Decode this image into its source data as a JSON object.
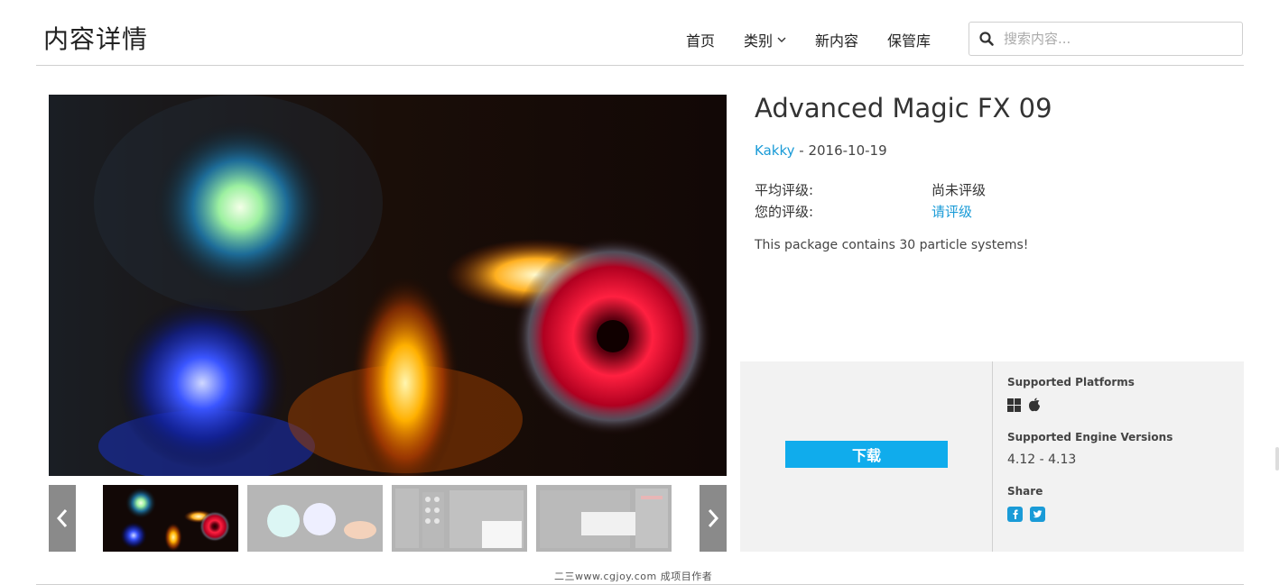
{
  "header": {
    "title": "内容详情",
    "nav": [
      {
        "label": "首页"
      },
      {
        "label": "类别",
        "has_dropdown": true
      },
      {
        "label": "新内容"
      },
      {
        "label": "保管库"
      }
    ],
    "search": {
      "placeholder": "搜索内容..."
    }
  },
  "asset": {
    "title": "Advanced Magic FX 09",
    "author": "Kakky",
    "separator": " - ",
    "date": "2016-10-19",
    "ratings": {
      "average_label": "平均评级:",
      "average_value": "尚未评级",
      "yours_label": "您的评级:",
      "yours_value": "请评级"
    },
    "description": "This package contains 30 particle systems!"
  },
  "gallery": {
    "active_index": 0,
    "thumb_count": 4
  },
  "panel": {
    "download_label": "下载",
    "platforms_label": "Supported Platforms",
    "platform_icons": [
      "windows-icon",
      "apple-icon"
    ],
    "engine_label": "Supported Engine Versions",
    "engine_versions": "4.12 - 4.13",
    "share_label": "Share",
    "share_icons": [
      "facebook-icon",
      "twitter-icon"
    ]
  },
  "watermark": "二三www.cgjoy.com 成项目作者",
  "colors": {
    "accent": "#10acec",
    "link": "#1a9bd7",
    "panel_bg": "#f2f2f2",
    "arrow_bg": "#8a8a8a"
  }
}
